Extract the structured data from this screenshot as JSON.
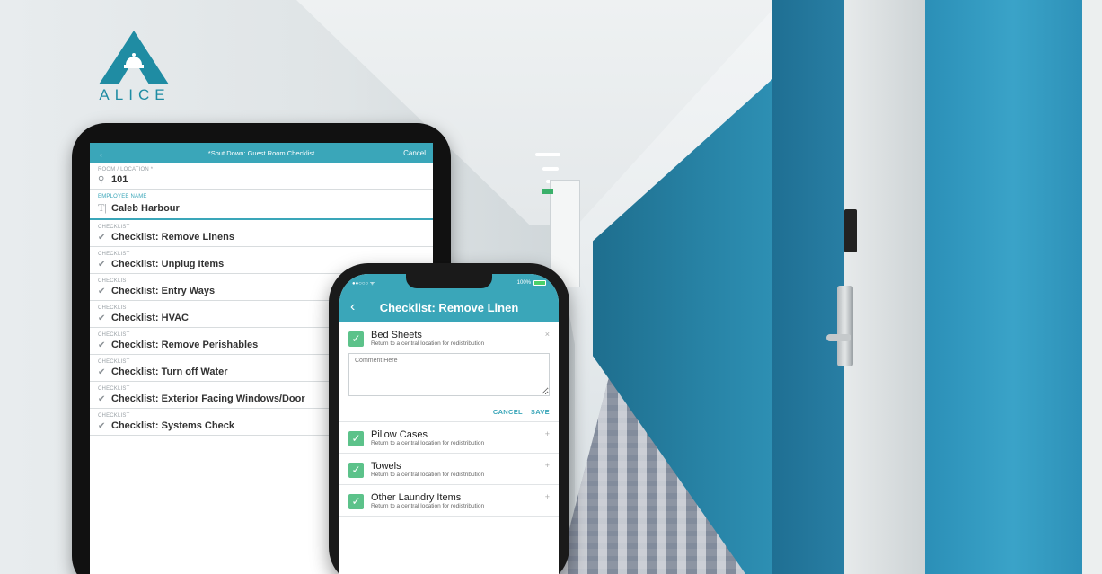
{
  "brand": {
    "logo_text": "ALICE",
    "accent": "#3aa6b9",
    "logo_color": "#1f8ca3"
  },
  "tablet": {
    "back_icon": "arrow-left-icon",
    "title": "*Shut Down: Guest Room Checklist",
    "cancel_label": "Cancel",
    "room_field": {
      "label": "ROOM / LOCATION *",
      "value": "101",
      "icon": "location-pin-icon"
    },
    "employee_field": {
      "label": "EMPLOYEE NAME",
      "value": "Caleb Harbour",
      "icon": "text-icon"
    },
    "checklist_label": "CHECKLIST",
    "checklists": [
      "Checklist: Remove Linens",
      "Checklist: Unplug Items",
      "Checklist: Entry Ways",
      "Checklist: HVAC",
      "Checklist: Remove Perishables",
      "Checklist: Turn off Water",
      "Checklist: Exterior Facing Windows/Door",
      "Checklist: Systems Check"
    ]
  },
  "phone": {
    "status": {
      "carrier": "●●○○○ ᯤ",
      "battery": "100%"
    },
    "title": "Checklist: Remove Linen",
    "items": [
      {
        "name": "Bed Sheets",
        "desc": "Return to a central location for redistribution",
        "toggle": "×"
      },
      {
        "name": "Pillow Cases",
        "desc": "Return to a central location for redistribution",
        "toggle": "+"
      },
      {
        "name": "Towels",
        "desc": "Return to a central location for redistribution",
        "toggle": "+"
      },
      {
        "name": "Other Laundry Items",
        "desc": "Return to a central location for redistribution",
        "toggle": "+"
      }
    ],
    "comment_placeholder": "Comment Here",
    "cancel_label": "CANCEL",
    "save_label": "SAVE"
  }
}
